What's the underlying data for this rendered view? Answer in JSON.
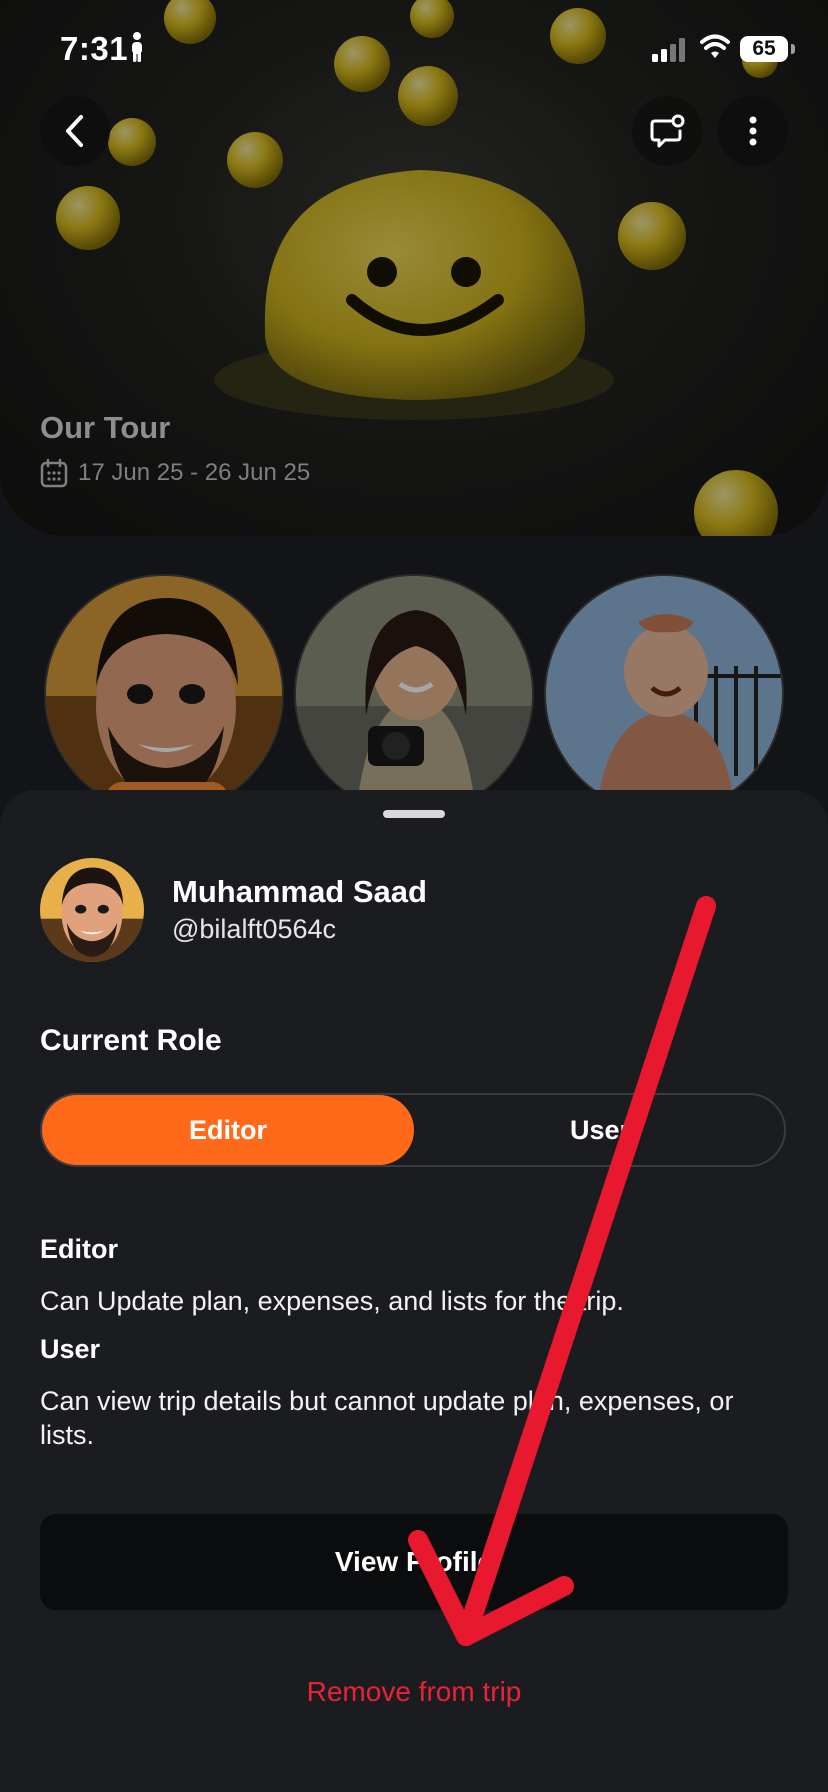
{
  "status_bar": {
    "time": "7:31",
    "battery": "65"
  },
  "trip": {
    "title": "Our Tour",
    "dates": "17 Jun 25 - 26 Jun 25"
  },
  "member_sheet": {
    "name": "Muhammad Saad",
    "handle": "@bilalft0564c",
    "current_role_heading": "Current Role",
    "roles": [
      {
        "label": "Editor",
        "selected": true
      },
      {
        "label": "User",
        "selected": false
      }
    ],
    "descriptions": [
      {
        "title": "Editor",
        "body": "Can Update plan, expenses, and lists for the trip."
      },
      {
        "title": "User",
        "body": "Can view trip details but cannot update plan, expenses, or lists."
      }
    ],
    "view_profile_label": "View Profile",
    "remove_label": "Remove from trip"
  },
  "colors": {
    "accent": "#ff6a1a",
    "danger": "#e8223a",
    "sheet_bg": "#1b1c1f",
    "annotation_arrow": "#e8182e"
  },
  "icons": [
    "back-icon",
    "chat-icon",
    "more-icon",
    "calendar-icon",
    "person-icon",
    "signal-icon",
    "wifi-icon"
  ]
}
